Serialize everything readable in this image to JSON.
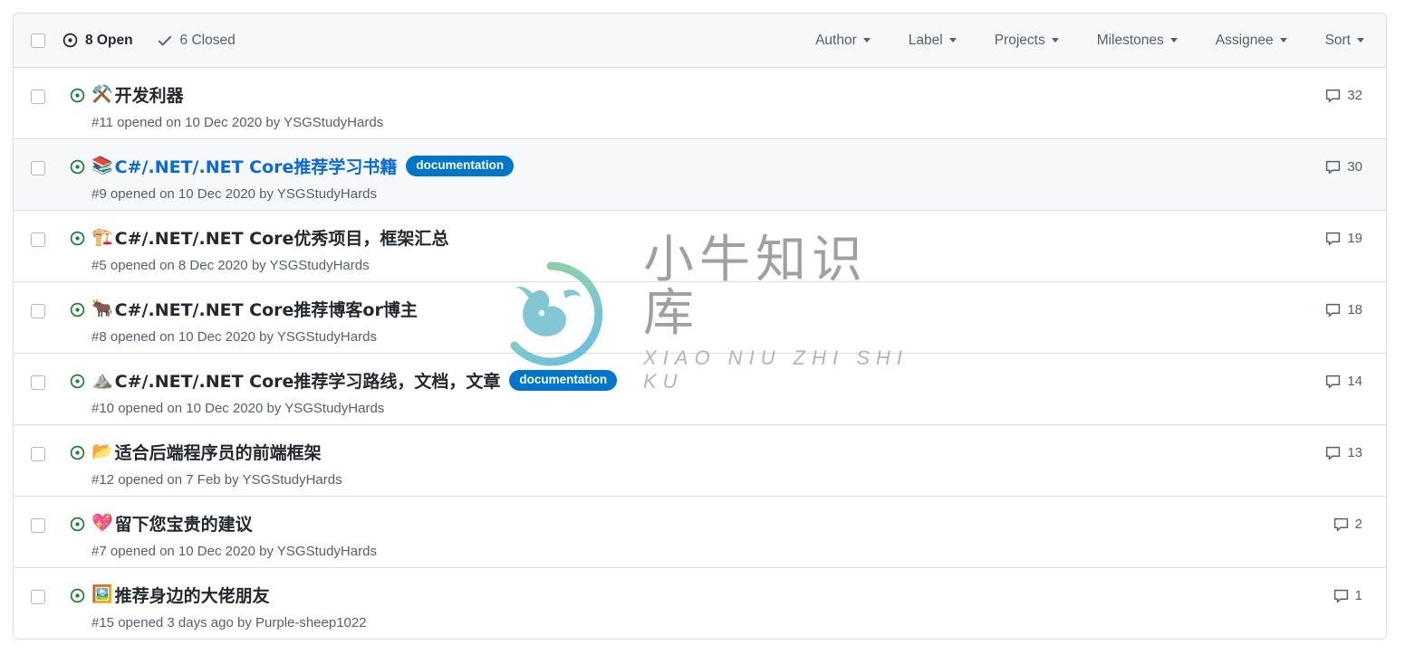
{
  "header": {
    "select_all_checkbox": "",
    "states": [
      {
        "name": "open",
        "label": "8 Open",
        "icon": "issue-opened-icon"
      },
      {
        "name": "closed",
        "label": "6 Closed",
        "icon": "check-icon"
      }
    ],
    "filters": [
      {
        "name": "author",
        "label": "Author"
      },
      {
        "name": "label",
        "label": "Label"
      },
      {
        "name": "projects",
        "label": "Projects"
      },
      {
        "name": "milestones",
        "label": "Milestones"
      },
      {
        "name": "assignee",
        "label": "Assignee"
      },
      {
        "name": "sort",
        "label": "Sort"
      }
    ]
  },
  "colors": {
    "open_icon_green": "#1a7f37",
    "link_blue": "#0969da",
    "label_documentation": "#0075ca",
    "text_primary": "#24292f",
    "text_muted": "#57606a",
    "border": "#d8dee4",
    "row_hover_bg": "#f6f8fa"
  },
  "issues": [
    {
      "emoji": "⚒️",
      "emoji_name": "hammer-and-pick-icon",
      "title": "开发利器",
      "meta": "#11 opened on 10 Dec 2020 by YSGStudyHards",
      "labels": [],
      "comments": "32",
      "hovered": false
    },
    {
      "emoji": "📚",
      "emoji_name": "books-icon",
      "title": "C#/.NET/.NET Core推荐学习书籍",
      "meta": "#9 opened on 10 Dec 2020 by YSGStudyHards",
      "labels": [
        {
          "text": "documentation",
          "color": "#0075ca"
        }
      ],
      "comments": "30",
      "hovered": true
    },
    {
      "emoji": "🏗️",
      "emoji_name": "building-construction-icon",
      "title": "C#/.NET/.NET Core优秀项目，框架汇总",
      "meta": "#5 opened on 8 Dec 2020 by YSGStudyHards",
      "labels": [],
      "comments": "19",
      "hovered": false
    },
    {
      "emoji": "🐂",
      "emoji_name": "ox-face-icon",
      "title": "C#/.NET/.NET Core推荐博客or博主",
      "meta": "#8 opened on 10 Dec 2020 by YSGStudyHards",
      "labels": [],
      "comments": "18",
      "hovered": false
    },
    {
      "emoji": "⛰️",
      "emoji_name": "mountain-icon",
      "title": "C#/.NET/.NET Core推荐学习路线，文档，文章",
      "meta": "#10 opened on 10 Dec 2020 by YSGStudyHards",
      "labels": [
        {
          "text": "documentation",
          "color": "#0075ca"
        }
      ],
      "comments": "14",
      "hovered": false
    },
    {
      "emoji": "📂",
      "emoji_name": "open-file-folder-icon",
      "title": "适合后端程序员的前端框架",
      "meta": "#12 opened on 7 Feb by YSGStudyHards",
      "labels": [],
      "comments": "13",
      "hovered": false
    },
    {
      "emoji": "💖",
      "emoji_name": "sparkling-heart-icon",
      "title": "留下您宝贵的建议",
      "meta": "#7 opened on 10 Dec 2020 by YSGStudyHards",
      "labels": [],
      "comments": "2",
      "hovered": false
    },
    {
      "emoji": "🖼️",
      "emoji_name": "framed-picture-icon",
      "title": "推荐身边的大佬朋友",
      "meta": "#15 opened 3 days ago by Purple-sheep1022",
      "labels": [],
      "comments": "1",
      "hovered": false
    }
  ],
  "watermark": {
    "cn_text": "小牛知识库",
    "en_text": "XIAO NIU ZHI SHI KU",
    "logo_name": "ox-logo"
  }
}
